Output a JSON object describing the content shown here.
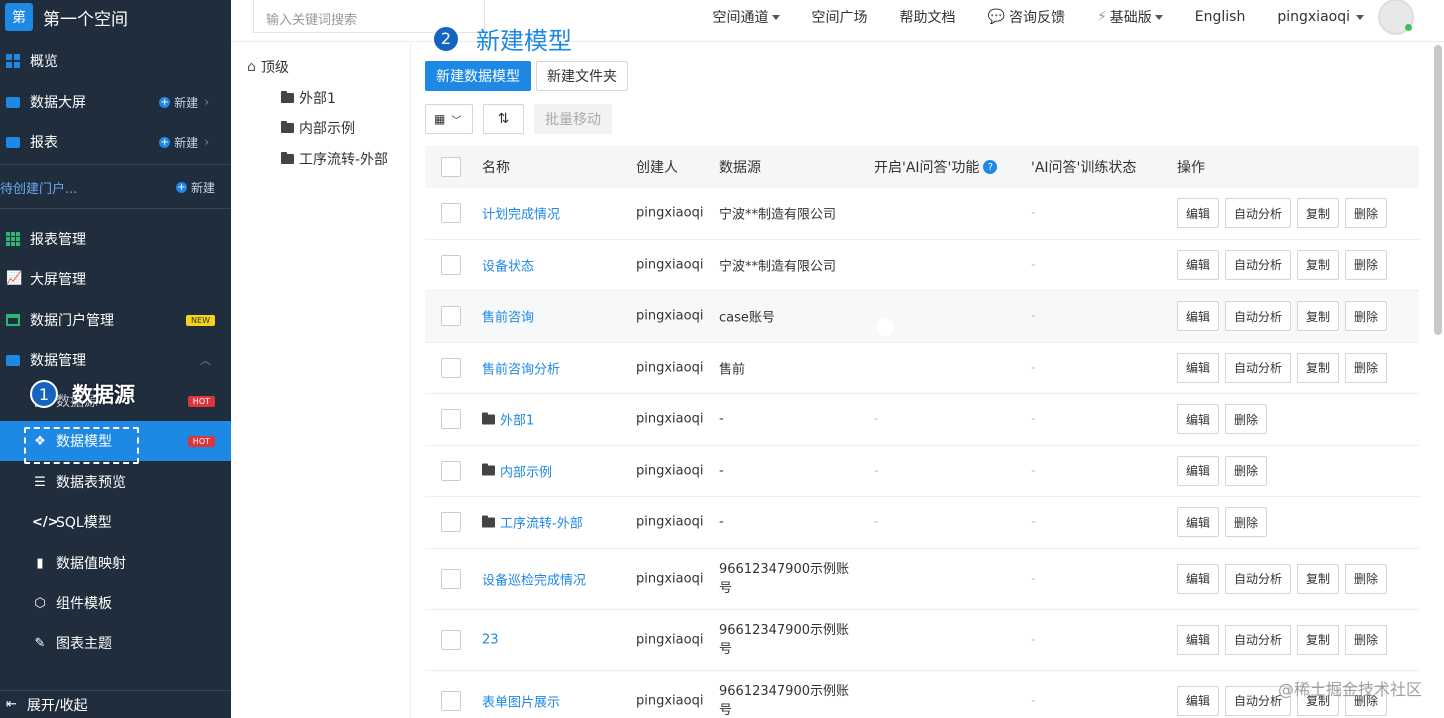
{
  "sidebar": {
    "logo_char": "第",
    "space_name": "第一个空间",
    "nav": [
      {
        "label": "概览"
      },
      {
        "label": "数据大屏",
        "action": "新建"
      },
      {
        "label": "报表",
        "action": "新建"
      }
    ],
    "portal": {
      "label": "待创建门户...",
      "action": "新建"
    },
    "manage": [
      {
        "label": "报表管理"
      },
      {
        "label": "大屏管理"
      },
      {
        "label": "数据门户管理",
        "badge": "NEW"
      },
      {
        "label": "数据管理"
      }
    ],
    "data_sub": [
      {
        "label": "数据源",
        "badge": "HOT"
      },
      {
        "label": "数据模型",
        "badge": "HOT"
      },
      {
        "label": "数据表预览"
      },
      {
        "label": "SQL模型"
      },
      {
        "label": "数据值映射"
      },
      {
        "label": "组件模板"
      },
      {
        "label": "图表主题"
      }
    ],
    "footer": "展开/收起"
  },
  "callouts": {
    "one": {
      "num": "1",
      "text": "数据源"
    },
    "two": {
      "num": "2",
      "text": "新建模型"
    }
  },
  "topbar": {
    "search_placeholder": "输入关键词搜索",
    "nav": [
      "空间通道",
      "空间广场",
      "帮助文档",
      "咨询反馈",
      "基础版",
      "English",
      "pingxiaoqi"
    ]
  },
  "tree": {
    "root": "顶级",
    "folders": [
      "外部1",
      "内部示例",
      "工序流转-外部"
    ]
  },
  "toolbar": {
    "new_model": "新建数据模型",
    "new_folder": "新建文件夹",
    "batch_move": "批量移动"
  },
  "table": {
    "headers": [
      "名称",
      "创建人",
      "数据源",
      "开启'AI问答'功能",
      "'AI问答'训练状态",
      "操作"
    ],
    "actions": {
      "edit": "编辑",
      "analyze": "自动分析",
      "copy": "复制",
      "delete": "删除"
    },
    "rows": [
      {
        "name": "计划完成情况",
        "creator": "pingxiaoqi",
        "source": "宁波**制造有限公司",
        "status": "-"
      },
      {
        "name": "设备状态",
        "creator": "pingxiaoqi",
        "source": "宁波**制造有限公司",
        "status": "-"
      },
      {
        "name": "售前咨询",
        "creator": "pingxiaoqi",
        "source": "case账号",
        "status": "-"
      },
      {
        "name": "售前咨询分析",
        "creator": "pingxiaoqi",
        "source": "售前",
        "status": "-"
      },
      {
        "name": "外部1",
        "creator": "pingxiaoqi",
        "source": "-",
        "ai": "-",
        "status": "-"
      },
      {
        "name": "内部示例",
        "creator": "pingxiaoqi",
        "source": "-",
        "ai": "-",
        "status": "-"
      },
      {
        "name": "工序流转-外部",
        "creator": "pingxiaoqi",
        "source": "-",
        "ai": "-",
        "status": "-"
      },
      {
        "name": "设备巡检完成情况",
        "creator": "pingxiaoqi",
        "source_l1": "96612347900示例账",
        "source_l2": "号",
        "status": "-"
      },
      {
        "name": "23",
        "creator": "pingxiaoqi",
        "source_l1": "96612347900示例账",
        "source_l2": "号",
        "status": "-"
      },
      {
        "name": "表单图片展示",
        "creator": "pingxiaoqi",
        "source_l1": "96612347900示例账",
        "source_l2": "号",
        "status": "-"
      }
    ]
  },
  "watermark": "@稀土掘金技术社区"
}
